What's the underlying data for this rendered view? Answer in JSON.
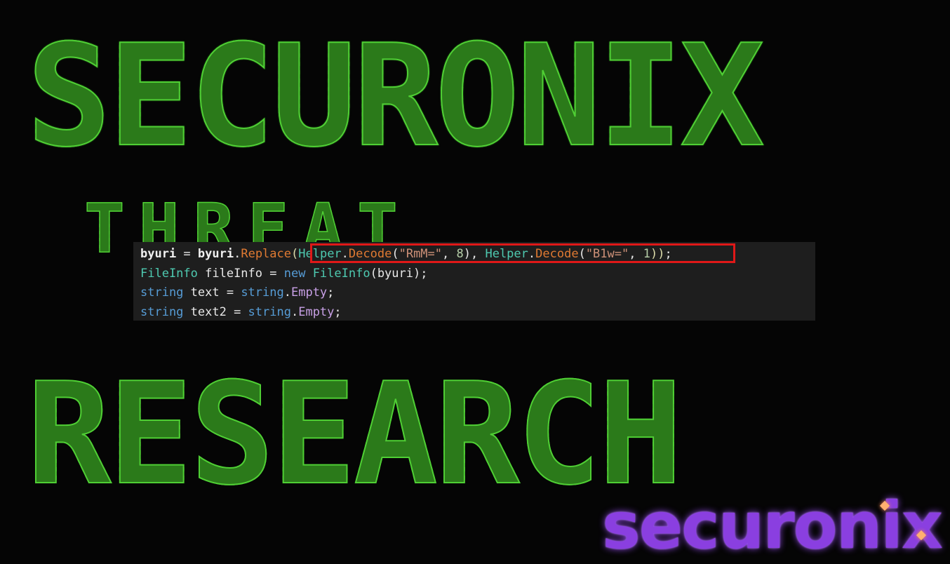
{
  "banner": {
    "line1": "SECURONIX",
    "line2": "THREAT",
    "line3": "RESEARCH"
  },
  "code": {
    "line1": {
      "var": "byuri",
      "eq": " = ",
      "obj": "byuri",
      "dot": ".",
      "method": "Replace",
      "open": "(",
      "helper1": "Helper",
      "decode1": "Decode",
      "args1_open": "(",
      "str1": "\"RmM=\"",
      "comma1": ", ",
      "num1": "8",
      "args1_close": "), ",
      "helper2": "Helper",
      "decode2": "Decode",
      "args2_open": "(",
      "str2": "\"B1w=\"",
      "comma2": ", ",
      "num2": "1",
      "close": "))",
      "semi": ";"
    },
    "line2": {
      "type": "FileInfo",
      "rest1": " fileInfo = ",
      "kw": "new",
      "sp": " ",
      "ctor": "FileInfo",
      "args": "(byuri);"
    },
    "line3": {
      "kw": "string",
      "rest": " text = ",
      "kw2": "string",
      "dot": ".",
      "prop": "Empty",
      "semi": ";"
    },
    "line4": {
      "kw": "string",
      "rest": " text2 = ",
      "kw2": "string",
      "dot": ".",
      "prop": "Empty",
      "semi": ";"
    }
  },
  "logo": {
    "text": "securonix"
  },
  "colors": {
    "ascii_green": "#5cd43a",
    "code_bg": "#1e1e1e",
    "highlight": "#e01818",
    "logo_purple": "#8a3fe0"
  }
}
